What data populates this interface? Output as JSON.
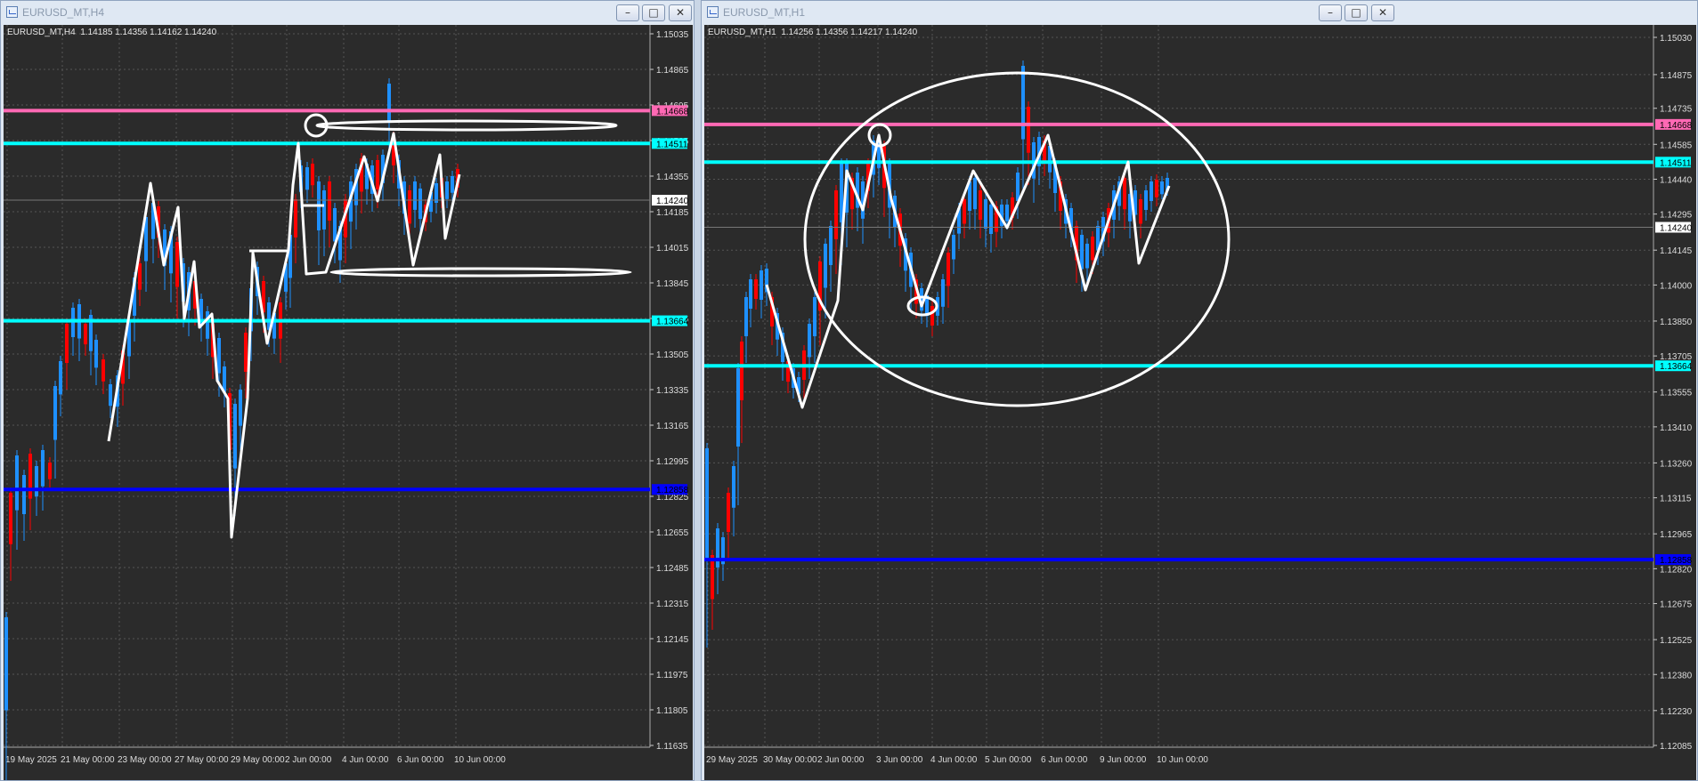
{
  "windows": [
    {
      "title": "EURUSD_MT,H4",
      "info_symbol": "EURUSD_MT,H4",
      "info_ohlc": "1.14185 1.14356 1.14162 1.14240",
      "price_ticks": [
        "1.15035",
        "1.14865",
        "1.14695",
        "1.14525",
        "1.14355",
        "1.14185",
        "1.14015",
        "1.13845",
        "1.13675",
        "1.13505",
        "1.13335",
        "1.13165",
        "1.12995",
        "1.12825",
        "1.12655",
        "1.12485",
        "1.12315",
        "1.12145",
        "1.11975",
        "1.11805",
        "1.11635"
      ],
      "time_ticks": [
        "19 May 2025",
        "21 May 00:00",
        "23 May 00:00",
        "27 May 00:00",
        "29 May 00:00",
        "2 Jun 00:00",
        "4 Jun 00:00",
        "6 Jun 00:00",
        "10 Jun 00:00"
      ],
      "hlines": [
        {
          "price": 1.14668,
          "color": "#ff69b4",
          "label": "1.14668"
        },
        {
          "price": 1.14511,
          "color": "#00ffff",
          "label": "1.14511"
        },
        {
          "price": 1.13664,
          "color": "#00ffff",
          "label": "1.13664"
        },
        {
          "price": 1.12858,
          "color": "#0000ff",
          "label": "1.12858"
        }
      ],
      "current_price": "1.14240"
    },
    {
      "title": "EURUSD_MT,H1",
      "info_symbol": "EURUSD_MT,H1",
      "info_ohlc": "1.14256 1.14356 1.14217 1.14240",
      "price_ticks": [
        "1.15030",
        "1.14875",
        "1.14735",
        "1.14585",
        "1.14440",
        "1.14295",
        "1.14145",
        "1.14000",
        "1.13850",
        "1.13705",
        "1.13555",
        "1.13410",
        "1.13260",
        "1.13115",
        "1.12965",
        "1.12820",
        "1.12675",
        "1.12525",
        "1.12380",
        "1.12230",
        "1.12085"
      ],
      "time_ticks": [
        "29 May 2025",
        "30 May 00:00",
        "2 Jun 00:00",
        "3 Jun 00:00",
        "4 Jun 00:00",
        "5 Jun 00:00",
        "6 Jun 00:00",
        "9 Jun 00:00",
        "10 Jun 00:00"
      ],
      "hlines": [
        {
          "price": 1.14668,
          "color": "#ff69b4",
          "label": "1.14668"
        },
        {
          "price": 1.14511,
          "color": "#00ffff",
          "label": "1.14511"
        },
        {
          "price": 1.13664,
          "color": "#00ffff",
          "label": "1.13664"
        },
        {
          "price": 1.12858,
          "color": "#0000ff",
          "label": "1.12858"
        }
      ],
      "current_price": "1.14240"
    }
  ],
  "colors": {
    "bull": "#1e90ff",
    "bear": "#ff0000",
    "background": "#2b2b2b",
    "grid": "#555555",
    "drawing": "#ffffff"
  },
  "icons": [
    "chart-window-icon",
    "minimize-icon",
    "maximize-icon",
    "close-icon"
  ]
}
